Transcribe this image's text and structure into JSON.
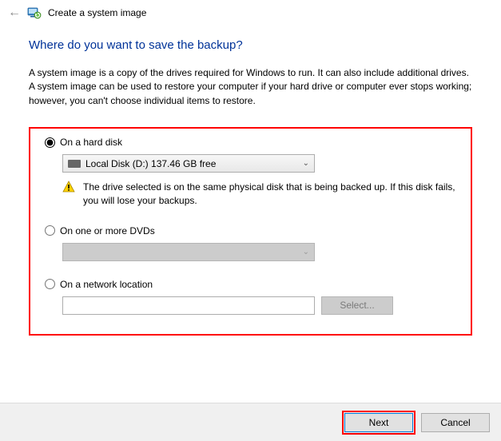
{
  "titlebar": {
    "title": "Create a system image"
  },
  "heading": "Where do you want to save the backup?",
  "description": "A system image is a copy of the drives required for Windows to run. It can also include additional drives. A system image can be used to restore your computer if your hard drive or computer ever stops working; however, you can't choose individual items to restore.",
  "options": {
    "hard_disk": {
      "label": "On a hard disk",
      "selected_drive": "Local Disk (D:)  137.46 GB free",
      "warning": "The drive selected is on the same physical disk that is being backed up. If this disk fails, you will lose your backups."
    },
    "dvd": {
      "label": "On one or more DVDs"
    },
    "network": {
      "label": "On a network location",
      "select_button": "Select..."
    }
  },
  "footer": {
    "next": "Next",
    "cancel": "Cancel"
  }
}
